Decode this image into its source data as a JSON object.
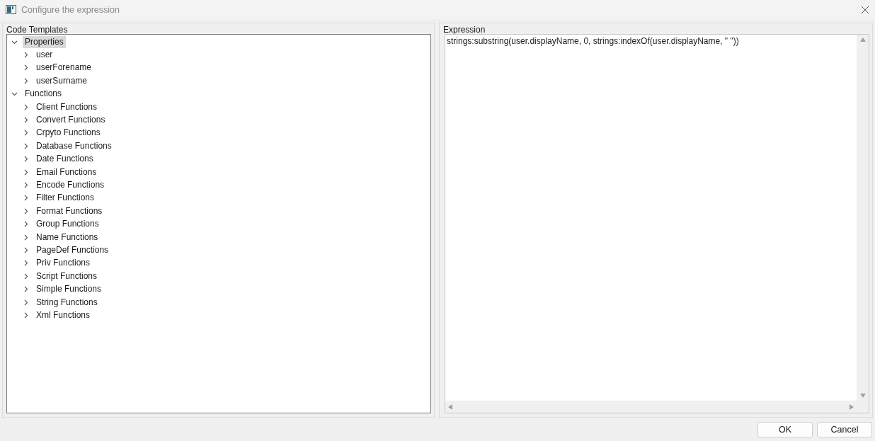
{
  "window": {
    "title": "Configure the expression"
  },
  "code_templates": {
    "label": "Code Templates",
    "tree": [
      {
        "label": "Properties",
        "expanded": true,
        "selected": true,
        "children": [
          {
            "label": "user",
            "expanded": false,
            "selected": false
          },
          {
            "label": "userForename",
            "expanded": false,
            "selected": false
          },
          {
            "label": "userSurname",
            "expanded": false,
            "selected": false
          }
        ]
      },
      {
        "label": "Functions",
        "expanded": true,
        "selected": false,
        "children": [
          {
            "label": "Client Functions",
            "expanded": false,
            "selected": false
          },
          {
            "label": "Convert Functions",
            "expanded": false,
            "selected": false
          },
          {
            "label": "Crpyto Functions",
            "expanded": false,
            "selected": false
          },
          {
            "label": "Database Functions",
            "expanded": false,
            "selected": false
          },
          {
            "label": "Date Functions",
            "expanded": false,
            "selected": false
          },
          {
            "label": "Email Functions",
            "expanded": false,
            "selected": false
          },
          {
            "label": "Encode Functions",
            "expanded": false,
            "selected": false
          },
          {
            "label": "Filter Functions",
            "expanded": false,
            "selected": false
          },
          {
            "label": "Format Functions",
            "expanded": false,
            "selected": false
          },
          {
            "label": "Group Functions",
            "expanded": false,
            "selected": false
          },
          {
            "label": "Name Functions",
            "expanded": false,
            "selected": false
          },
          {
            "label": "PageDef Functions",
            "expanded": false,
            "selected": false
          },
          {
            "label": "Priv Functions",
            "expanded": false,
            "selected": false
          },
          {
            "label": "Script Functions",
            "expanded": false,
            "selected": false
          },
          {
            "label": "Simple Functions",
            "expanded": false,
            "selected": false
          },
          {
            "label": "String Functions",
            "expanded": false,
            "selected": false
          },
          {
            "label": "Xml Functions",
            "expanded": false,
            "selected": false
          }
        ]
      }
    ]
  },
  "expression": {
    "label": "Expression",
    "value": "strings:substring(user.displayName, 0, strings:indexOf(user.displayName, \" \"))"
  },
  "buttons": [
    "OK",
    "Cancel"
  ]
}
